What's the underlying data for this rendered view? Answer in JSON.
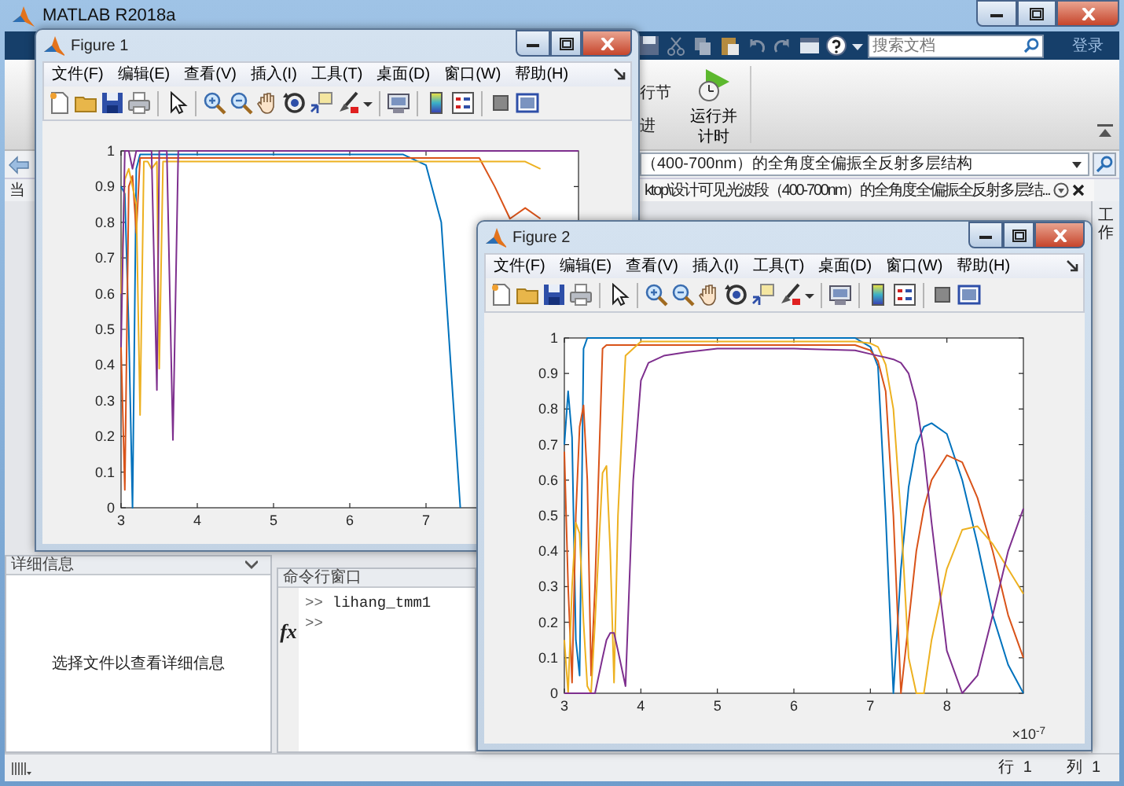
{
  "window": {
    "title": "MATLAB R2018a"
  },
  "quick_access": {
    "search": {
      "placeholder": "搜索文档"
    },
    "sign_in": "登录"
  },
  "ribbon": {
    "cut_labels": [
      "行节",
      "进"
    ],
    "run_button": {
      "label_lines": [
        "运行并",
        "计时"
      ]
    }
  },
  "address_bar": {
    "path": "（400-700nm）的全角度全偏振全反射多层结构"
  },
  "folder_tab": {
    "label": "当"
  },
  "editor_tab": {
    "title": "ktop\\设计可见光波段（400-700nm）的全角度全偏振全反射多层结..."
  },
  "side_panel": {
    "label": "工作"
  },
  "details_panel": {
    "title": "详细信息",
    "message": "选择文件以查看详细信息"
  },
  "command_window": {
    "title": "命令行窗口",
    "function_icon": "fx",
    "lines": [
      {
        "prompt": ">>",
        "text": "lihang_tmm1"
      },
      {
        "prompt": ">>"
      }
    ]
  },
  "status_bar": [
    {
      "label": "行",
      "value": "1"
    },
    {
      "label": "列",
      "value": "1"
    }
  ],
  "figures": [
    {
      "title": "Figure 1",
      "menus": [
        "文件(F)",
        "编辑(E)",
        "查看(V)",
        "插入(I)",
        "工具(T)",
        "桌面(D)",
        "窗口(W)",
        "帮助(H)"
      ],
      "chart_data": {
        "type": "line",
        "xlim": [
          3,
          9
        ],
        "ylim": [
          0,
          1
        ],
        "xticks": [
          3,
          4,
          5,
          6,
          7
        ],
        "yticks": [
          0,
          0.1,
          0.2,
          0.3,
          0.4,
          0.5,
          0.6,
          0.7,
          0.8,
          0.9,
          1
        ],
        "x": [
          3,
          3.05,
          3.1,
          3.15,
          3.2,
          3.25,
          3.3,
          3.35,
          3.4,
          3.47,
          3.5,
          3.55,
          3.6,
          3.68,
          3.75,
          4,
          5,
          6,
          6.7,
          7,
          7.2,
          7.45,
          7.7,
          7.9,
          8.1,
          8.3,
          8.5,
          8.7,
          9
        ],
        "series": [
          {
            "color": "#0072bd",
            "values": [
              0.9,
              0.88,
              0.5,
              0,
              0.95,
              0.99,
              0.99,
              0.99,
              0.99,
              0.99,
              0.99,
              0.99,
              0.99,
              0.99,
              0.99,
              0.99,
              0.99,
              0.99,
              0.99,
              0.96,
              0.8,
              0,
              null,
              null,
              null,
              null,
              null,
              null,
              null
            ]
          },
          {
            "color": "#d95319",
            "values": [
              0.45,
              0.05,
              0.9,
              0.93,
              0.77,
              0.98,
              0.98,
              0.98,
              0.98,
              0.98,
              0.98,
              0.98,
              0.98,
              0.98,
              0.98,
              0.98,
              0.98,
              0.98,
              0.98,
              0.98,
              0.98,
              0.98,
              0.98,
              0.9,
              0.81,
              0.84,
              0.81,
              null,
              null
            ]
          },
          {
            "color": "#edb120",
            "values": [
              0.6,
              0.92,
              0.95,
              0.9,
              0.85,
              0.26,
              0.97,
              0.97,
              0.95,
              0.97,
              0.39,
              0.97,
              0.97,
              0.97,
              0.97,
              0.97,
              0.97,
              0.97,
              0.97,
              0.97,
              0.97,
              0.97,
              0.97,
              0.97,
              0.97,
              0.97,
              0.95,
              null,
              null
            ]
          },
          {
            "color": "#7e2f8e",
            "values": [
              0.45,
              1,
              1,
              0.95,
              1,
              1,
              1,
              1,
              1,
              0.33,
              1,
              1,
              1,
              0.19,
              1,
              1,
              1,
              1,
              1,
              1,
              1,
              1,
              1,
              1,
              1,
              1,
              1,
              1,
              1
            ]
          }
        ]
      }
    },
    {
      "title": "Figure 2",
      "menus": [
        "文件(F)",
        "编辑(E)",
        "查看(V)",
        "插入(I)",
        "工具(T)",
        "桌面(D)",
        "窗口(W)",
        "帮助(H)"
      ],
      "x_multiplier": "×10$^{-7}$",
      "chart_data": {
        "type": "line",
        "xlim": [
          3,
          9
        ],
        "ylim": [
          0,
          1
        ],
        "xticks": [
          3,
          4,
          5,
          6,
          7,
          8
        ],
        "yticks": [
          0,
          0.1,
          0.2,
          0.3,
          0.4,
          0.5,
          0.6,
          0.7,
          0.8,
          0.9,
          1
        ],
        "x": [
          3,
          3.05,
          3.1,
          3.15,
          3.2,
          3.25,
          3.3,
          3.35,
          3.4,
          3.5,
          3.55,
          3.6,
          3.65,
          3.7,
          3.8,
          3.9,
          4,
          4.1,
          4.3,
          4.6,
          5,
          6,
          6.8,
          7,
          7.1,
          7.2,
          7.3,
          7.4,
          7.5,
          7.6,
          7.7,
          7.8,
          8,
          8.2,
          8.4,
          8.6,
          8.8,
          9
        ],
        "series": [
          {
            "color": "#0072bd",
            "values": [
              0.7,
              0.85,
              0.72,
              0.15,
              0.05,
              0.97,
              1,
              1,
              1,
              1,
              1,
              1,
              1,
              1,
              1,
              1,
              1,
              1,
              1,
              1,
              1,
              1,
              1,
              0.975,
              0.92,
              0.5,
              0,
              0.35,
              0.58,
              0.7,
              0.75,
              0.76,
              0.73,
              0.6,
              0.42,
              0.22,
              0.08,
              0
            ]
          },
          {
            "color": "#d95319",
            "values": [
              0.68,
              0.3,
              0.03,
              0.5,
              0.75,
              0.81,
              0.6,
              0.05,
              0.3,
              0.97,
              0.98,
              0.98,
              0.98,
              0.98,
              0.98,
              0.98,
              0.98,
              0.98,
              0.98,
              0.98,
              0.98,
              0.98,
              0.98,
              0.965,
              0.935,
              0.85,
              0.5,
              0,
              0.2,
              0.4,
              0.52,
              0.6,
              0.67,
              0.65,
              0.55,
              0.4,
              0.22,
              0.1
            ]
          },
          {
            "color": "#edb120",
            "values": [
              0.15,
              0,
              0.3,
              0.48,
              0.45,
              0.2,
              0.02,
              0,
              0.2,
              0.62,
              0.64,
              0.4,
              0.03,
              0.5,
              0.95,
              0.97,
              0.99,
              0.99,
              0.99,
              0.99,
              0.99,
              0.99,
              0.99,
              0.985,
              0.975,
              0.925,
              0.8,
              0.5,
              0.1,
              0,
              0,
              0.15,
              0.35,
              0.46,
              0.47,
              0.42,
              0.35,
              0.28
            ]
          },
          {
            "color": "#7e2f8e",
            "values": [
              0,
              0,
              0,
              0,
              0,
              0,
              0,
              0,
              0,
              0.1,
              0.15,
              0.17,
              0.17,
              0.12,
              0.02,
              0.6,
              0.88,
              0.93,
              0.95,
              0.96,
              0.97,
              0.97,
              0.965,
              0.955,
              0.95,
              0.945,
              0.94,
              0.93,
              0.9,
              0.82,
              0.68,
              0.48,
              0.12,
              0,
              0.05,
              0.22,
              0.4,
              0.52
            ]
          }
        ]
      }
    }
  ]
}
